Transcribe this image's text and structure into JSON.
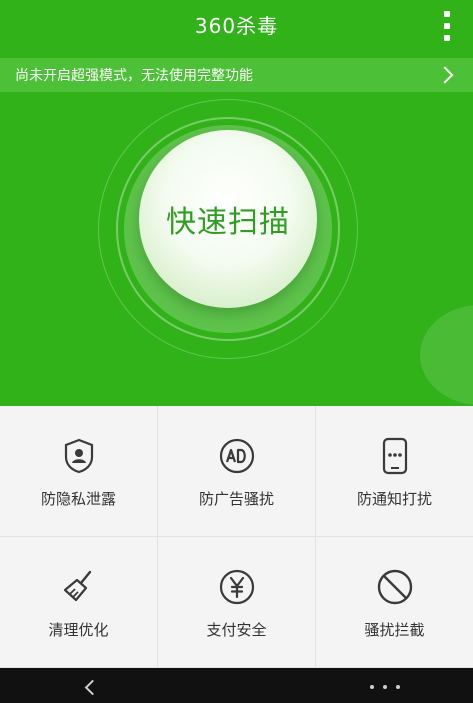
{
  "header": {
    "title": "360杀毒",
    "menu_icon": "more-vertical-icon"
  },
  "notice": {
    "text": "尚未开启超强模式，无法使用完整功能",
    "arrow_icon": "chevron-right-icon"
  },
  "scan": {
    "label": "快速扫描"
  },
  "features": [
    {
      "label": "防隐私泄露",
      "icon": "shield-user-icon"
    },
    {
      "label": "防广告骚扰",
      "icon": "ad-circle-icon"
    },
    {
      "label": "防通知打扰",
      "icon": "phone-notification-icon"
    },
    {
      "label": "清理优化",
      "icon": "broom-icon"
    },
    {
      "label": "支付安全",
      "icon": "yen-circle-icon"
    },
    {
      "label": "骚扰拦截",
      "icon": "block-circle-icon"
    }
  ],
  "navbar": {
    "back_icon": "back-chevron-icon",
    "more_icon": "more-dots-icon"
  },
  "colors": {
    "primary_green": "#31b219",
    "notice_bar": "#4cc036",
    "scan_text": "#2f9e22",
    "feature_text": "#333333",
    "icon_stroke": "#3a3a3a",
    "navbar": "#111111"
  }
}
